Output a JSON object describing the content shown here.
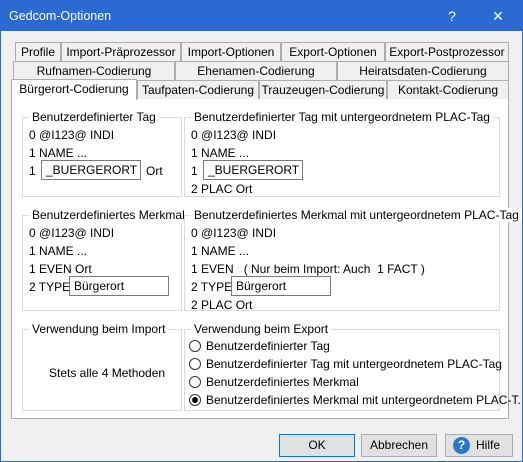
{
  "window": {
    "title": "Gedcom-Optionen",
    "help_glyph": "?",
    "close_glyph": "✕"
  },
  "tabs": {
    "row1": [
      "Profile",
      "Import-Präprozessor",
      "Import-Optionen",
      "Export-Optionen",
      "Export-Postprozessor"
    ],
    "row2": [
      "Rufnamen-Codierung",
      "Ehenamen-Codierung",
      "Heiratsdaten-Codierung"
    ],
    "row3": [
      "Bürgerort-Codierung",
      "Taufpaten-Codierung",
      "Trauzeugen-Codierung",
      "Kontakt-Codierung"
    ],
    "active": "Bürgerort-Codierung"
  },
  "custom_tag": {
    "title": "Benutzerdefinierter Tag",
    "line1": "0 @I123@ INDI",
    "line2": "1 NAME ...",
    "prefix": "1",
    "value": "_BUERGERORT",
    "suffix": "Ort"
  },
  "custom_tag_plac": {
    "title": "Benutzerdefinierter Tag mit untergeordnetem PLAC-Tag",
    "line1": "0 @I123@ INDI",
    "line2": "1 NAME ...",
    "prefix": "1",
    "value": "_BUERGERORT",
    "line4": "2 PLAC Ort"
  },
  "custom_fact": {
    "title": "Benutzerdefiniertes Merkmal",
    "line1": "0 @I123@ INDI",
    "line2": "1 NAME ...",
    "line3": "1 EVEN Ort",
    "type_label": "2 TYPE",
    "type_value": "Bürgerort"
  },
  "custom_fact_plac": {
    "title": "Benutzerdefiniertes Merkmal mit untergeordnetem PLAC-Tag",
    "line1": "0 @I123@ INDI",
    "line2": "1 NAME ...",
    "line3": "1 EVEN   ( Nur beim Import: Auch  1 FACT )",
    "type_label": "2 TYPE",
    "type_value": "Bürgerort",
    "line5": "2 PLAC Ort"
  },
  "import_usage": {
    "title": "Verwendung beim Import",
    "text": "Stets alle 4 Methoden"
  },
  "export_usage": {
    "title": "Verwendung beim Export",
    "options": [
      "Benutzerdefinierter Tag",
      "Benutzerdefinierter Tag mit untergeordnetem PLAC-Tag",
      "Benutzerdefiniertes Merkmal",
      "Benutzerdefiniertes Merkmal mit untergeordnetem PLAC-T."
    ],
    "selected_index": 3
  },
  "buttons": {
    "ok": "OK",
    "cancel": "Abbrechen",
    "help": "Hilfe",
    "help_glyph": "?"
  }
}
